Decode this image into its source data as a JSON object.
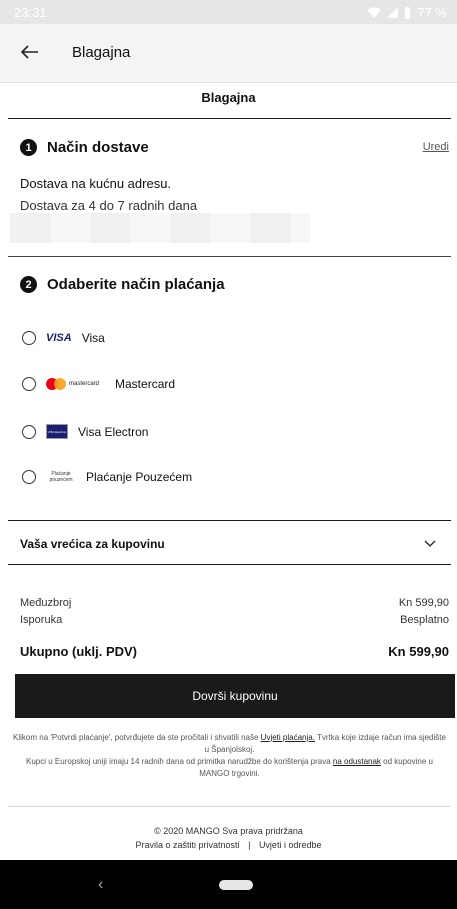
{
  "status_bar": {
    "time": "23:31",
    "battery": "77 %"
  },
  "app_bar": {
    "title": "Blagajna"
  },
  "page": {
    "header": "Blagajna"
  },
  "delivery": {
    "step_number": "1",
    "title": "Način dostave",
    "edit_label": "Uredi",
    "method": "Dostava na kućnu adresu.",
    "time": "Dostava za 4 do 7 radnih dana"
  },
  "payment": {
    "step_number": "2",
    "title": "Odaberite način plaćanja",
    "options": [
      {
        "label": "Visa",
        "logo_text": "VISA",
        "icon": "visa-logo"
      },
      {
        "label": "Mastercard",
        "logo_text": "mastercard",
        "icon": "mastercard-logo"
      },
      {
        "label": "Visa Electron",
        "logo_text": "VISA Electron",
        "icon": "visa-electron-logo"
      },
      {
        "label": "Plaćanje Pouzećem",
        "logo_text": "Plaćanje pouzećem",
        "icon": "cash-on-delivery-logo"
      }
    ]
  },
  "bag": {
    "title": "Vaša vrećica za kupovinu"
  },
  "summary": {
    "subtotal_label": "Međuzbroj",
    "subtotal_value": "Kn 599,90",
    "shipping_label": "Isporuka",
    "shipping_value": "Besplatno",
    "total_label": "Ukupno (uklj. PDV)",
    "total_value": "Kn 599,90"
  },
  "cta": {
    "label": "Dovrši kupovinu"
  },
  "legal": {
    "line1_a": "Klikom na 'Potvrdi plaćanje', potvrđujete da ste pročitali i shvatili naše",
    "line1_link": "Uvjeti plaćanja.",
    "line1_b": "Tvrtka koje izdaje račun ima sjedište u Španjolskoj.",
    "line2_a": "Kupci u Europskoj uniji imaju 14 radnih dana od primitka narudžbe do korištenja prava",
    "line2_link": "na odustanak",
    "line2_b": "od kupovine u MANGO trgovini."
  },
  "footer": {
    "copyright": "© 2020 MANGO Sva prava pridržana",
    "privacy": "Pravila o zaštiti privatnosti",
    "separator": "|",
    "terms": "Uvjeti i odredbe"
  },
  "nav_bar": {
    "back": "‹"
  },
  "colors": {
    "dark": "#1a1a1a",
    "visa_blue": "#1a1f71",
    "mc_red": "#eb001b",
    "mc_orange": "#f79e1b"
  }
}
